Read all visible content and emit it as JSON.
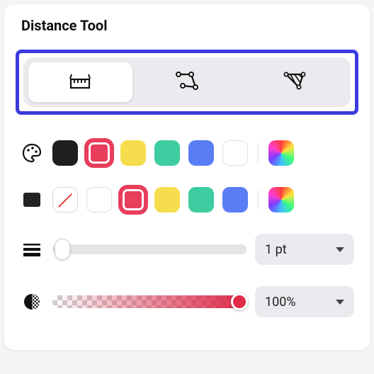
{
  "title": "Distance Tool",
  "modes": [
    {
      "name": "distance",
      "active": true
    },
    {
      "name": "perimeter",
      "active": false
    },
    {
      "name": "area",
      "active": false
    }
  ],
  "outline": {
    "swatches": [
      {
        "name": "black",
        "hex": "#1f1f1f",
        "selected": false
      },
      {
        "name": "red",
        "hex": "#E83D5B",
        "selected": true
      },
      {
        "name": "yellow",
        "hex": "#F6DD4E",
        "selected": false
      },
      {
        "name": "teal",
        "hex": "#3ECCA1",
        "selected": false
      },
      {
        "name": "blue",
        "hex": "#5A7CF4",
        "selected": false
      },
      {
        "name": "white",
        "hex": "#FFFFFF",
        "selected": false
      }
    ]
  },
  "fill": {
    "swatches": [
      {
        "name": "none",
        "hex": null,
        "selected": false
      },
      {
        "name": "white",
        "hex": "#FFFFFF",
        "selected": false
      },
      {
        "name": "red",
        "hex": "#E83D5B",
        "selected": true
      },
      {
        "name": "yellow",
        "hex": "#F6DD4E",
        "selected": false
      },
      {
        "name": "teal",
        "hex": "#3ECCA1",
        "selected": false
      },
      {
        "name": "blue",
        "hex": "#5A7CF4",
        "selected": false
      }
    ]
  },
  "lineWidth": {
    "label": "1 pt",
    "sliderPercent": 5
  },
  "opacity": {
    "label": "100%",
    "sliderPercent": 100
  }
}
